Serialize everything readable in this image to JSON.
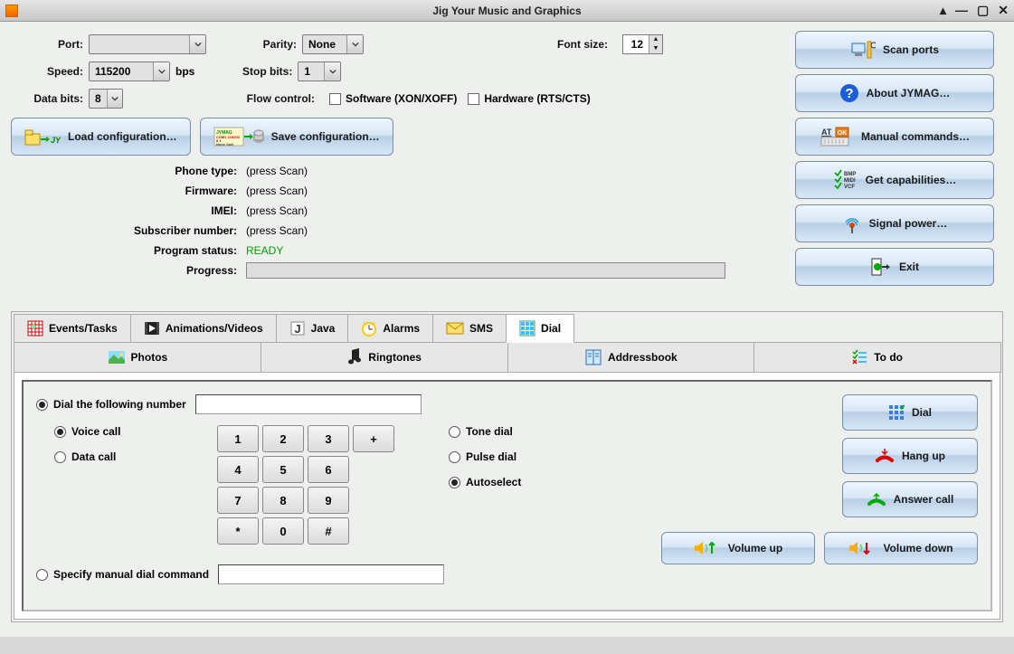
{
  "window": {
    "title": "Jig Your Music and Graphics"
  },
  "port_section": {
    "port_label": "Port:",
    "port_value": "",
    "parity_label": "Parity:",
    "parity_value": "None",
    "font_label": "Font size:",
    "font_value": "12",
    "speed_label": "Speed:",
    "speed_value": "115200",
    "speed_unit": "bps",
    "stop_label": "Stop bits:",
    "stop_value": "1",
    "data_label": "Data bits:",
    "data_value": "8",
    "flow_label": "Flow control:",
    "flow_soft": "Software (XON/XOFF)",
    "flow_hard": "Hardware (RTS/CTS)",
    "load_cfg": "Load configuration…",
    "save_cfg": "Save configuration…"
  },
  "info": {
    "phone_type_k": "Phone type:",
    "phone_type_v": "(press Scan)",
    "firmware_k": "Firmware:",
    "firmware_v": "(press Scan)",
    "imei_k": "IMEI:",
    "imei_v": "(press Scan)",
    "sub_k": "Subscriber number:",
    "sub_v": "(press Scan)",
    "status_k": "Program status:",
    "status_v": "READY",
    "progress_k": "Progress:"
  },
  "sidebar": {
    "scan": "Scan ports",
    "about": "About JYMAG…",
    "manual": "Manual commands…",
    "caps": "Get capabilities…",
    "signal": "Signal power…",
    "exit": "Exit"
  },
  "tabs_row1": {
    "events": "Events/Tasks",
    "anim": "Animations/Videos",
    "java": "Java",
    "alarms": "Alarms",
    "sms": "SMS",
    "dial": "Dial"
  },
  "tabs_row2": {
    "photos": "Photos",
    "ringtones": "Ringtones",
    "addressbook": "Addressbook",
    "todo": "To do"
  },
  "dialpane": {
    "radio_dialnum": "Dial the following number",
    "radio_voice": "Voice call",
    "radio_data": "Data call",
    "radio_tone": "Tone dial",
    "radio_pulse": "Pulse dial",
    "radio_auto": "Autoselect",
    "radio_manual": "Specify manual dial command",
    "keys": [
      "1",
      "2",
      "3",
      "+",
      "4",
      "5",
      "6",
      "",
      "7",
      "8",
      "9",
      "",
      "*",
      "0",
      "#",
      ""
    ],
    "btn_dial": "Dial",
    "btn_hangup": "Hang up",
    "btn_answer": "Answer call",
    "btn_volup": "Volume up",
    "btn_voldown": "Volume down"
  }
}
